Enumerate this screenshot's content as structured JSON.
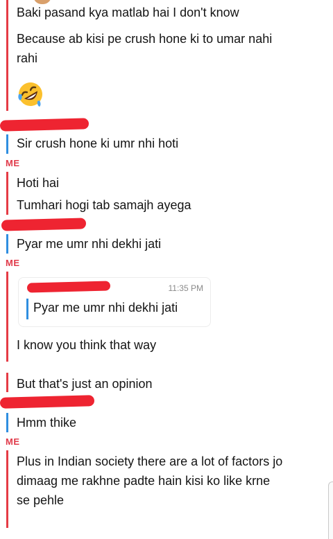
{
  "messages": {
    "cutoff_line": "Baki pasand kya matlab hai I don't know",
    "because": "Because ab kisi pe crush hone ki to umar nahi\nrahi",
    "emoji": "rofl-emoji",
    "sir_crush": "Sir crush hone ki umr nhi hoti",
    "hoti_hai": "Hoti hai",
    "tumhari": "Tumhari hogi tab samajh ayega",
    "pyar": "Pyar me umr nhi dekhi jati",
    "quote_time": "11:35 PM",
    "quote_text": "Pyar me umr nhi dekhi jati",
    "i_know": "I know you think that way",
    "opinion": "But that's just an opinion",
    "hmm": "Hmm thike",
    "plus": "Plus in Indian society there are a lot of factors jo\ndimaag me rakhne padte hain kisi ko like krne\nse pehle"
  },
  "labels": {
    "me1": "ME",
    "me2": "ME",
    "me3": "ME"
  },
  "colors": {
    "me_bar": "#e53b45",
    "other_bar": "#2f8ee0",
    "redaction": "#ee2431",
    "me_label": "#e03a4a"
  }
}
